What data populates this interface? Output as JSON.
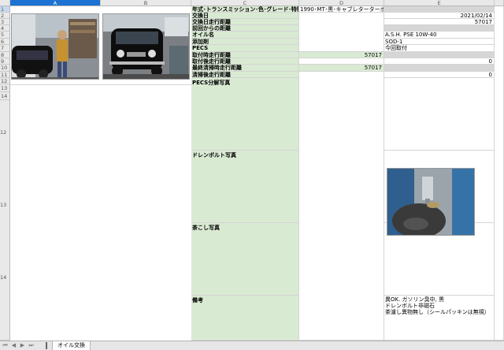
{
  "columns": [
    "A",
    "B",
    "C",
    "D",
    "E"
  ],
  "rows": [
    "1",
    "2",
    "3",
    "4",
    "5",
    "6",
    "7",
    "8",
    "9",
    "10",
    "11",
    "12",
    "13",
    "14",
    "15"
  ],
  "labels": {
    "r2": "年式･トランスミッション･色･グレード･特徴",
    "r3": "交換日",
    "r4": "交換日走行距離",
    "r5": "前回からの距離",
    "r6": "オイル名",
    "r7": "添加剤",
    "r8": "PECS",
    "r9": "取付時走行距離",
    "r10": "取付後走行距離",
    "r11": "最終清掃時走行距離",
    "r12": "清掃後走行距離",
    "r13": "PECS分解写真",
    "r14": "ドレンボルト写真",
    "r15": "茶こし写真",
    "r16": "備考"
  },
  "values": {
    "d2": "1990･MT･黒･キャブレターターボ",
    "e3": "2021/02/14",
    "e4": "57017",
    "e6": "A.S.H. PSE 10W-40",
    "e7": "SOD-1",
    "e8": "今回取付",
    "d9": "57017",
    "e10": "0",
    "d11": "57017",
    "e12": "0",
    "remarks": [
      "異OK. ガソリン臭中, 黒",
      "ドレンボルト非磁石",
      "茶濾し異物無し（シールパッキンは無視）"
    ]
  },
  "photos": {
    "a1": "man-in-garage-photo",
    "b1": "black-mini-car-photo",
    "e14": "drain-bolt-photo"
  },
  "sheet_tab": "オイル交換",
  "colors": {
    "label_green": "#d9ead3",
    "selected_header": "#1e73d2",
    "gray_row": "#d6d6d6"
  }
}
